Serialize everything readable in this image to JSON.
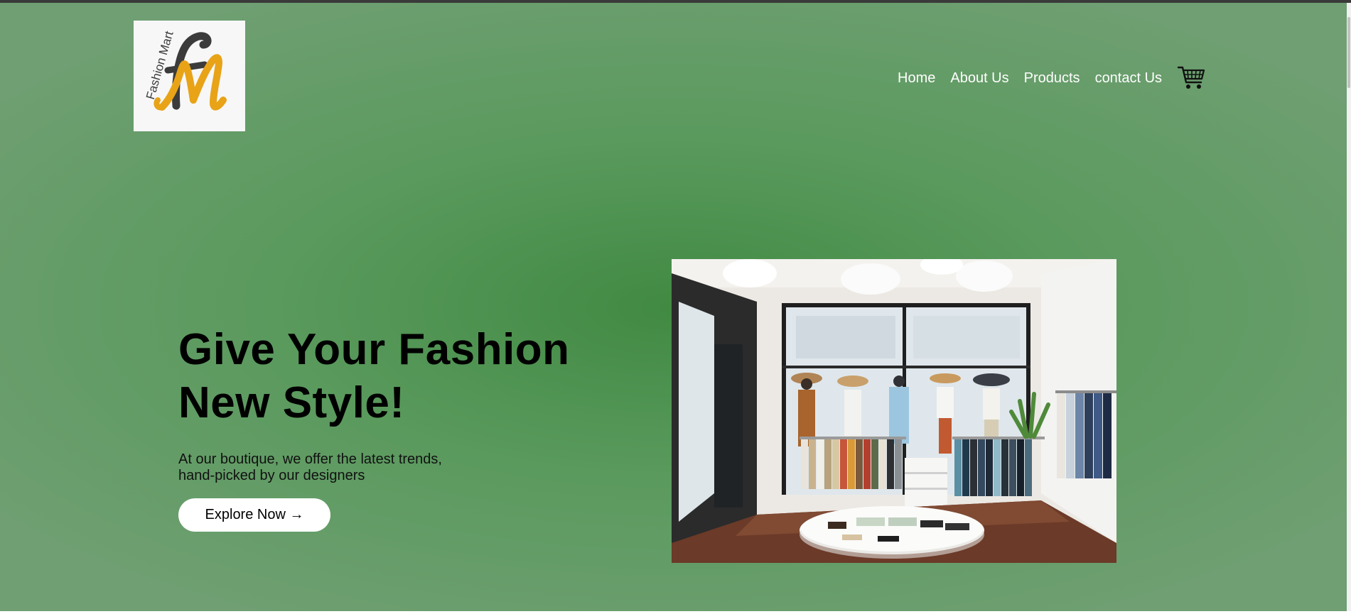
{
  "brand": {
    "logo_text": "Fashion Mart",
    "logo_icon": "fashion-mart-logo",
    "accent_color": "#e8a317",
    "dark_color": "#3b3b3b"
  },
  "nav": {
    "items": [
      {
        "label": "Home"
      },
      {
        "label": "About Us"
      },
      {
        "label": "Products"
      },
      {
        "label": "contact Us"
      }
    ],
    "cart_icon": "shopping-cart-icon"
  },
  "hero": {
    "title_line1": "Give Your Fashion",
    "title_line2": "New Style!",
    "subtitle_line1": "At our boutique, we offer the latest trends,",
    "subtitle_line2": "hand-picked by our designers",
    "cta_label": "Explore Now →",
    "image_desc_icon": "boutique-store-photo"
  },
  "colors": {
    "background_center": "#418a43",
    "background_edge": "#6f9f72",
    "nav_text": "#ffffff",
    "title_text": "#000000",
    "button_bg": "#ffffff"
  }
}
